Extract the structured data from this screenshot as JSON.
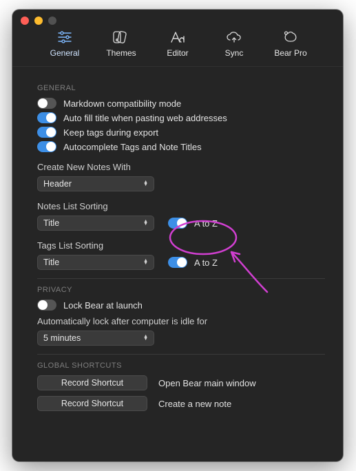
{
  "toolbar": {
    "general": "General",
    "themes": "Themes",
    "editor": "Editor",
    "sync": "Sync",
    "bearpro": "Bear Pro"
  },
  "sections": {
    "general_title": "GENERAL",
    "privacy_title": "PRIVACY",
    "shortcuts_title": "GLOBAL SHORTCUTS"
  },
  "general": {
    "markdown_compat": {
      "label": "Markdown compatibility mode",
      "on": false
    },
    "autofill_title": {
      "label": "Auto fill title when pasting web addresses",
      "on": true
    },
    "keep_tags_export": {
      "label": "Keep tags during export",
      "on": true
    },
    "autocomplete_tags": {
      "label": "Autocomplete Tags and Note Titles",
      "on": true
    },
    "create_new_label": "Create New Notes With",
    "create_new_value": "Header",
    "notes_sort_label": "Notes List Sorting",
    "notes_sort_value": "Title",
    "notes_sort_toggle": {
      "label": "A to Z",
      "on": true
    },
    "tags_sort_label": "Tags List Sorting",
    "tags_sort_value": "Title",
    "tags_sort_toggle": {
      "label": "A to Z",
      "on": true
    }
  },
  "privacy": {
    "lock_launch": {
      "label": "Lock Bear at launch",
      "on": false
    },
    "autolock_label": "Automatically lock after computer is idle for",
    "autolock_value": "5 minutes"
  },
  "shortcuts": {
    "record_label": "Record Shortcut",
    "open_main": "Open Bear main window",
    "new_note": "Create a new note"
  },
  "annotation": {
    "color": "#d13fd1"
  }
}
